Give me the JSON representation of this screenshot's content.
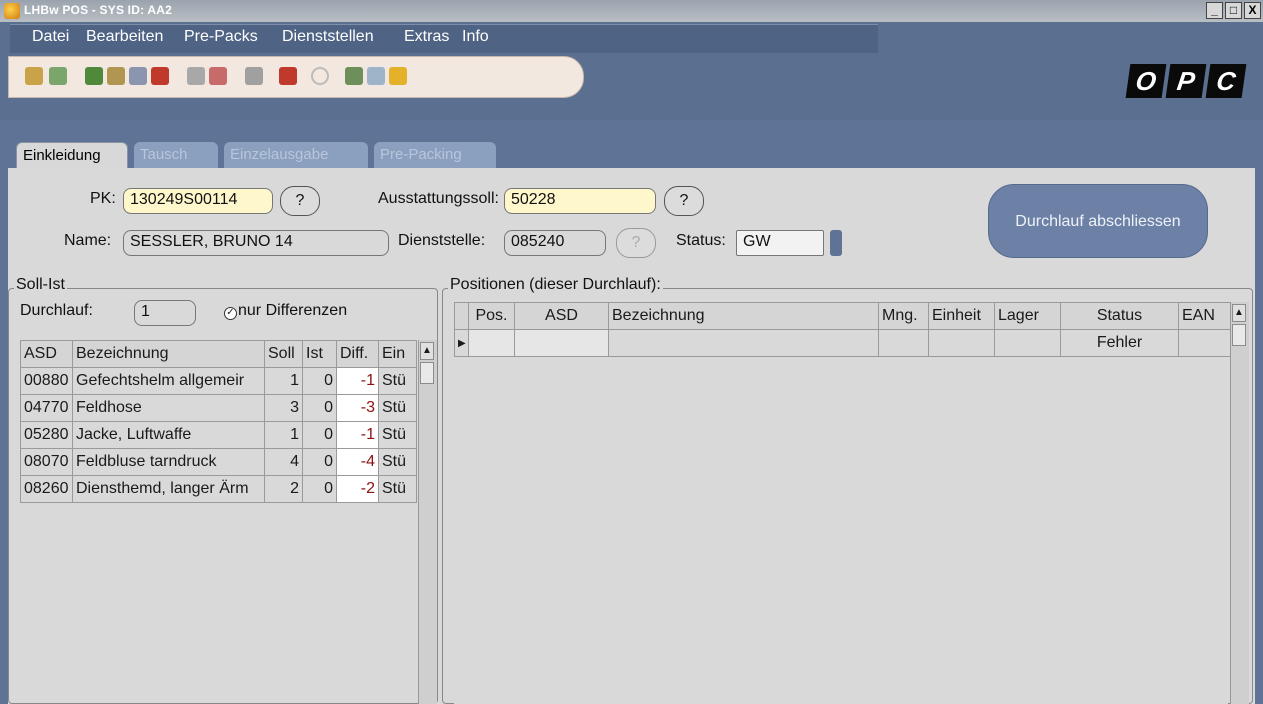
{
  "window": {
    "title": "LHBw POS - SYS ID: AA2",
    "min": "_",
    "max": "□",
    "close": "X"
  },
  "menu": [
    "Datei",
    "Bearbeiten",
    "Pre-Packs",
    "Dienststellen",
    "Extras",
    "Info"
  ],
  "logo": [
    "O",
    "P",
    "C"
  ],
  "tabs": [
    "Einkleidung",
    "Tausch",
    "Einzelausgabe",
    "Pre-Packing"
  ],
  "form": {
    "pk_label": "PK:",
    "pk_value": "130249S00114",
    "name_label": "Name:",
    "name_value": "SESSLER, BRUNO 14",
    "ausstattungssoll_label": "Ausstattungssoll:",
    "ausstattungssoll_value": "50228",
    "dienststelle_label": "Dienststelle:",
    "dienststelle_value": "085240",
    "status_label": "Status:",
    "status_value": "GW",
    "question": "?",
    "durchlauf_button": "Durchlauf abschliessen"
  },
  "sollist": {
    "title": "Soll-Ist",
    "durchlauf_label": "Durchlauf:",
    "durchlauf_value": "1",
    "checkbox_label": "nur Differenzen",
    "columns": [
      "ASD",
      "Bezeichnung",
      "Soll",
      "Ist",
      "Diff.",
      "Ein"
    ],
    "rows": [
      {
        "asd": "00880",
        "bez": "Gefechtshelm allgemeir",
        "soll": "1",
        "ist": "0",
        "diff": "-1",
        "ein": "Stü"
      },
      {
        "asd": "04770",
        "bez": "Feldhose",
        "soll": "3",
        "ist": "0",
        "diff": "-3",
        "ein": "Stü"
      },
      {
        "asd": "05280",
        "bez": "Jacke, Luftwaffe",
        "soll": "1",
        "ist": "0",
        "diff": "-1",
        "ein": "Stü"
      },
      {
        "asd": "08070",
        "bez": "Feldbluse tarndruck",
        "soll": "4",
        "ist": "0",
        "diff": "-4",
        "ein": "Stü"
      },
      {
        "asd": "08260",
        "bez": "Diensthemd, langer Ärm",
        "soll": "2",
        "ist": "0",
        "diff": "-2",
        "ein": "Stü"
      }
    ]
  },
  "positionen": {
    "title": "Positionen (dieser Durchlauf):",
    "columns": [
      "Pos.",
      "ASD",
      "Bezeichnung",
      "Mng.",
      "Einheit",
      "Lager",
      "Status",
      "EAN"
    ],
    "rows": [
      {
        "pos": "",
        "asd": "",
        "bez": "",
        "mng": "",
        "einheit": "",
        "lager": "",
        "status": "Fehler",
        "ean": ""
      }
    ]
  },
  "colors": {
    "accent": "#5f7396",
    "panel": "#d9d9d9",
    "highlight": "#fff7cc",
    "diff": "#8b1010"
  }
}
